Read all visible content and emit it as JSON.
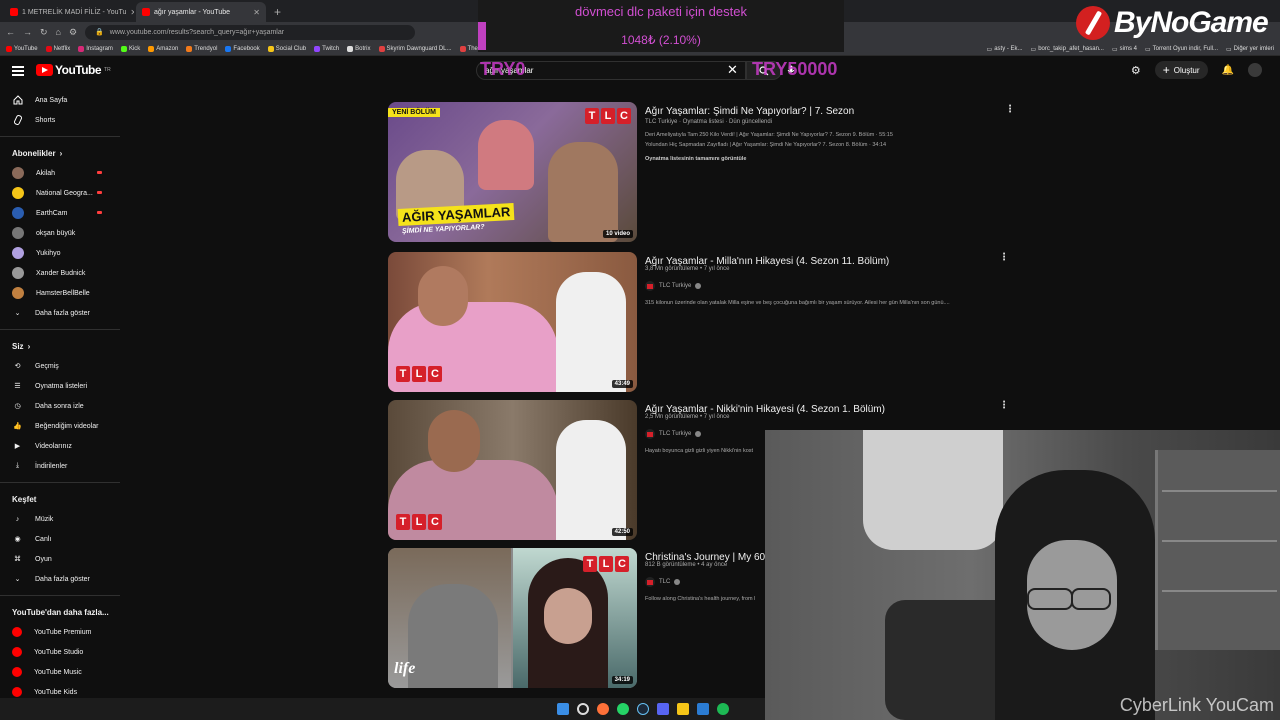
{
  "browser": {
    "tabs": [
      {
        "label": "1 METRELİK MADİ FİLİZ - YouTu"
      },
      {
        "label": "ağır yaşamlar - YouTube"
      }
    ],
    "url": "www.youtube.com/results?search_query=ağır+yaşamlar",
    "bookmarks": [
      {
        "label": "YouTube",
        "color": "#ff0000"
      },
      {
        "label": "Netflix",
        "color": "#e50914"
      },
      {
        "label": "Instagram",
        "color": "#d62976"
      },
      {
        "label": "Kick",
        "color": "#53fc18"
      },
      {
        "label": "Amazon",
        "color": "#ff9900"
      },
      {
        "label": "Trendyol",
        "color": "#f27a1a"
      },
      {
        "label": "Facebook",
        "color": "#1877f2"
      },
      {
        "label": "Social Club",
        "color": "#f5c518"
      },
      {
        "label": "Twitch",
        "color": "#9146ff"
      },
      {
        "label": "Botrix",
        "color": "#dddddd"
      },
      {
        "label": "Skyrim Dawnguard DL...",
        "color": "#e04040"
      },
      {
        "label": "The E",
        "color": "#e04040"
      }
    ],
    "bookmarks_right": [
      {
        "label": "asty - Ek..."
      },
      {
        "label": "borc_takip_afet_hasan..."
      },
      {
        "label": "sims 4"
      },
      {
        "label": "Torrent Oyun indir, Full..."
      },
      {
        "label": "Diğer yer imleri"
      }
    ]
  },
  "overlay": {
    "donation_title": "dövmeci dlc paketi için destek",
    "donation_amount": "1048₺ (2.10%)",
    "brand": "ByNoGame",
    "goal_left": "TRY0",
    "goal_right": "TRY50000"
  },
  "youtube": {
    "logo": "YouTube",
    "logo_country": "TR",
    "search_value": "ağır yaşamlar",
    "create_label": "Oluştur",
    "sidebar": {
      "main": [
        {
          "label": "Ana Sayfa",
          "icon": "home-icon"
        },
        {
          "label": "Shorts",
          "icon": "shorts-icon"
        }
      ],
      "subs_title": "Abonelikler",
      "subs": [
        {
          "label": "Akilah",
          "color": "#8a6a5a",
          "live": true
        },
        {
          "label": "National Geogra...",
          "color": "#f5c518",
          "live": true
        },
        {
          "label": "EarthCam",
          "color": "#2a5db0",
          "live": true
        },
        {
          "label": "okşan büyük",
          "color": "#777777",
          "live": false
        },
        {
          "label": "Yukihyo",
          "color": "#b0a0e0",
          "live": false
        },
        {
          "label": "Xander Budnick",
          "color": "#999999",
          "live": false
        },
        {
          "label": "HamsterBellBelle",
          "color": "#c08040",
          "live": false
        }
      ],
      "subs_more": "Daha fazla göster",
      "you_title": "Siz",
      "you": [
        {
          "label": "Geçmiş",
          "icon": "history-icon"
        },
        {
          "label": "Oynatma listeleri",
          "icon": "playlists-icon"
        },
        {
          "label": "Daha sonra izle",
          "icon": "watch-later-icon"
        },
        {
          "label": "Beğendiğim videolar",
          "icon": "like-icon"
        },
        {
          "label": "Videolarınız",
          "icon": "your-videos-icon"
        },
        {
          "label": "İndirilenler",
          "icon": "download-icon"
        }
      ],
      "explore_title": "Keşfet",
      "explore": [
        {
          "label": "Müzik",
          "icon": "music-icon"
        },
        {
          "label": "Canlı",
          "icon": "live-icon"
        },
        {
          "label": "Oyun",
          "icon": "gaming-icon"
        }
      ],
      "explore_more": "Daha fazla göster",
      "more_title": "YouTube'dan daha fazla...",
      "more": [
        {
          "label": "YouTube Premium"
        },
        {
          "label": "YouTube Studio"
        },
        {
          "label": "YouTube Music"
        },
        {
          "label": "YouTube Kids"
        }
      ]
    },
    "results": [
      {
        "title": "Ağır Yaşamlar: Şimdi Ne Yapıyorlar? | 7. Sezon",
        "meta": "TLC Turkiye · Oynatma listesi · Dün güncellendi",
        "lines": [
          "Deri Ameliyatıyla Tam 250 Kilo Verdi! | Ağır Yaşamlar: Şimdi Ne Yapıyorlar? 7. Sezon 9. Bölüm · 55:15",
          "Yolundan Hiç Sapmadan Zayıfladı | Ağır Yaşamlar: Şimdi Ne Yapıyorlar? 7. Sezon 8. Bölüm · 34:14"
        ],
        "view_full": "Oynatma listesinin tamamını görüntüle",
        "badge": "10 video",
        "thumb_badge": "YENİ BÖLÜM",
        "thumb_title": "AĞIR YAŞAMLAR",
        "thumb_subtitle": "ŞİMDİ NE YAPIYORLAR?"
      },
      {
        "title": "Ağır Yaşamlar - Milla'nın Hikayesi (4. Sezon 11. Bölüm)",
        "meta": "3,8 Mn görüntüleme • 7 yıl önce",
        "channel": "TLC Turkiye",
        "desc": "315 kilonun üzerinde olan yatalak Milla eşine ve beş çocuğuna bağımlı bir yaşam sürüyor. Ailesi her gün Milla'nın son günü....",
        "duration": "43:49"
      },
      {
        "title": "Ağır Yaşamlar - Nikki'nin Hikayesi (4. Sezon 1. Bölüm)",
        "meta": "2,5 Mn görüntüleme • 7 yıl önce",
        "channel": "TLC Turkiye",
        "desc": "Hayatı boyunca gizli gizli yiyen Nikki'nin kost",
        "duration": "42:50"
      },
      {
        "title": "Christina's Journey | My 600-lb",
        "meta": "812 B görüntüleme • 4 ay önce",
        "channel": "TLC",
        "desc": "Follow along Christina's health journey, from l",
        "duration": "34:19",
        "thumb_logo": "life"
      }
    ]
  },
  "webcam": {
    "watermark": "CyberLink YouCam"
  }
}
